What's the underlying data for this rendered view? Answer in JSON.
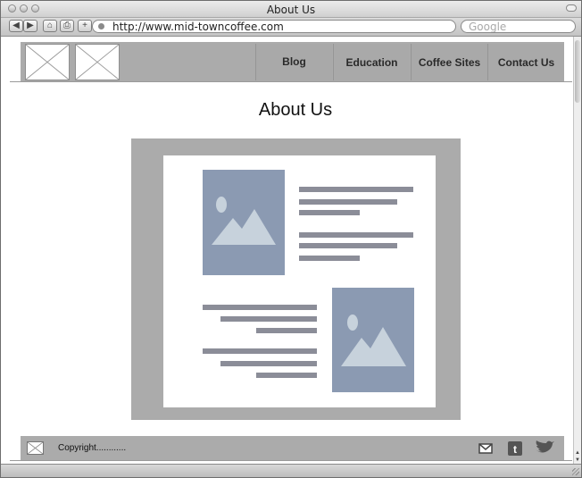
{
  "window": {
    "title": "About Us"
  },
  "toolbar": {
    "url": "http://www.mid-towncoffee.com",
    "search_placeholder": "Google",
    "buttons": {
      "back": "◀",
      "forward": "▶",
      "home": "⌂",
      "print": "⎙",
      "add": "+"
    }
  },
  "site": {
    "nav": {
      "items": [
        {
          "label": "Blog"
        },
        {
          "label": "Education"
        },
        {
          "label": "Coffee Sites"
        },
        {
          "label": "Contact Us"
        }
      ]
    },
    "page_title": "About Us",
    "footer": {
      "copyright": "Copyright............"
    }
  },
  "colors": {
    "header_bg": "#ababab",
    "image_placeholder": "#8b9ab2",
    "image_mountain": "#c7d2dc",
    "text_line": "#8b8d98"
  },
  "icons": {
    "logo": "image-placeholder-icon",
    "footer": [
      "mail-icon",
      "tumblr-icon",
      "twitter-bird-icon"
    ]
  }
}
